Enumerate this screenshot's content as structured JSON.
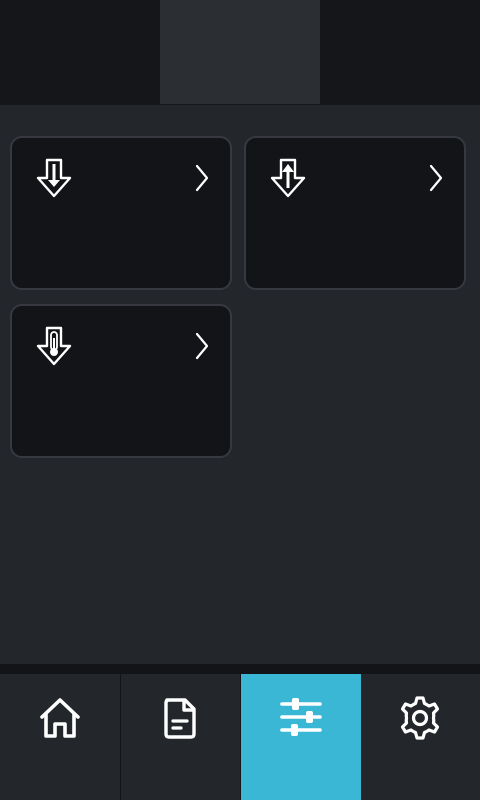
{
  "top_tabs": [
    {
      "name": "tab-1",
      "active": false
    },
    {
      "name": "tab-2",
      "active": true
    },
    {
      "name": "tab-3",
      "active": false
    }
  ],
  "cards": [
    {
      "icon": "inlet-arrow-down-icon",
      "title": "",
      "value": ""
    },
    {
      "icon": "outlet-arrow-up-icon",
      "title": "",
      "value": ""
    },
    {
      "icon": "thermometer-icon",
      "title": "",
      "value": ""
    }
  ],
  "bottom_nav": {
    "items": [
      {
        "icon": "home-icon",
        "active": false
      },
      {
        "icon": "document-icon",
        "active": false
      },
      {
        "icon": "sliders-icon",
        "active": true
      },
      {
        "icon": "gear-icon",
        "active": false
      }
    ],
    "active_color": "#3ab7d4"
  },
  "colors": {
    "background": "#23262b",
    "card_background": "#121417",
    "card_border": "#363a40",
    "icon": "#ffffff"
  }
}
